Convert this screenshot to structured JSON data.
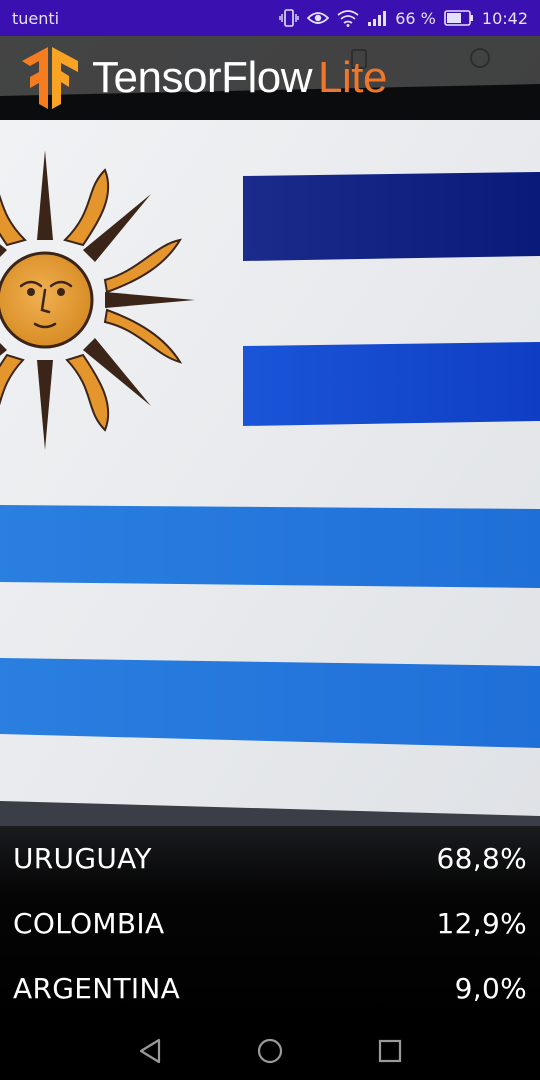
{
  "status_bar": {
    "carrier": "tuenti",
    "battery_percent": "66 %",
    "time": "10:42",
    "icons": [
      "vibrate-icon",
      "eye-icon",
      "wifi-icon",
      "signal-icon",
      "battery-icon"
    ]
  },
  "header": {
    "brand_main": "TensorFlow",
    "brand_accent": "Lite",
    "accent_color": "#f0762a",
    "logo_icon": "tensorflow-logo-icon"
  },
  "results": [
    {
      "label": "URUGUAY",
      "value": "68,8%"
    },
    {
      "label": "COLOMBIA",
      "value": "12,9%"
    },
    {
      "label": "ARGENTINA",
      "value": "9,0%"
    }
  ],
  "nav": {
    "icons": [
      "back-icon",
      "home-icon",
      "recents-icon"
    ]
  }
}
